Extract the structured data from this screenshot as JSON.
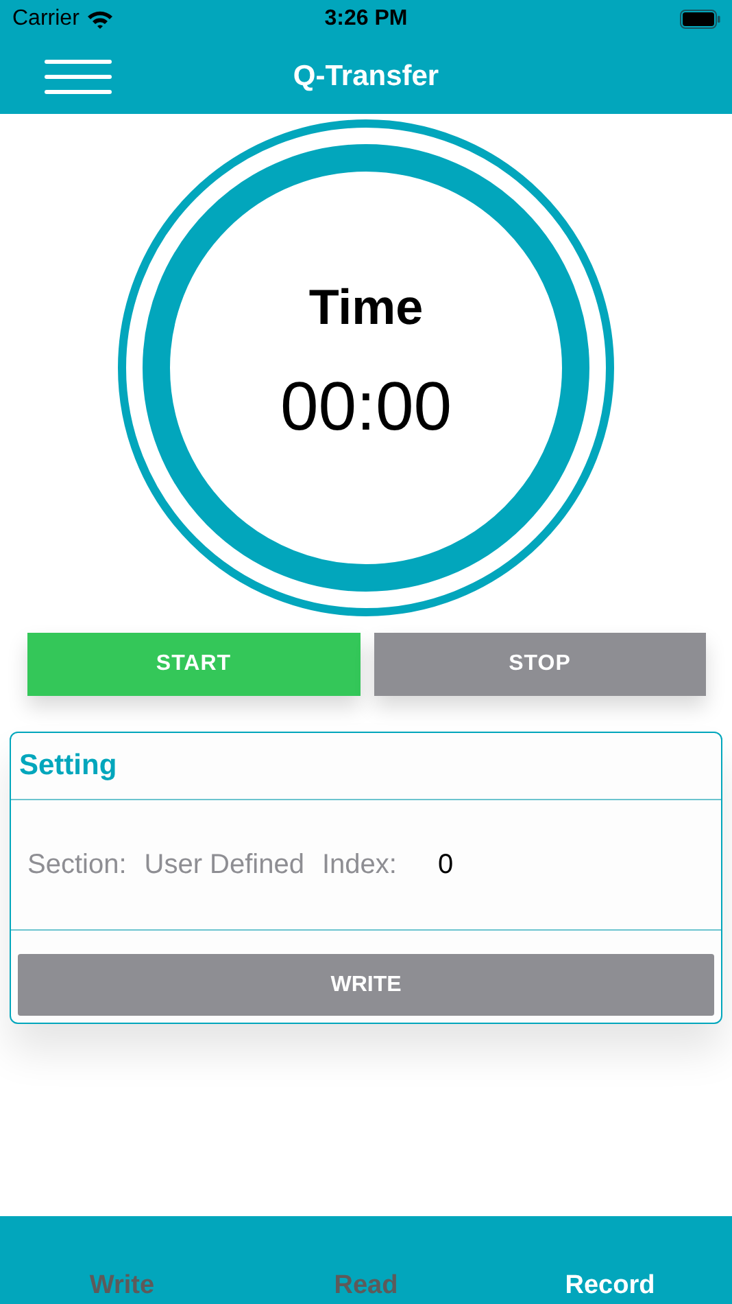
{
  "status_bar": {
    "carrier": "Carrier",
    "time": "3:26 PM"
  },
  "nav_bar": {
    "title": "Q-Transfer"
  },
  "timer": {
    "label": "Time",
    "value": "00:00"
  },
  "buttons": [
    {
      "label": "START",
      "color": "#34c759"
    },
    {
      "label": "STOP",
      "color": "#8e8e93"
    }
  ],
  "setting": {
    "title": "Setting",
    "section_label": "Section:",
    "section_value": "User Defined",
    "index_label": "Index:",
    "index_value": "0",
    "button": "WRITE"
  },
  "tabs": [
    {
      "label": "Write",
      "selected": false
    },
    {
      "label": "Read",
      "selected": false
    },
    {
      "label": "Record",
      "selected": true
    }
  ]
}
